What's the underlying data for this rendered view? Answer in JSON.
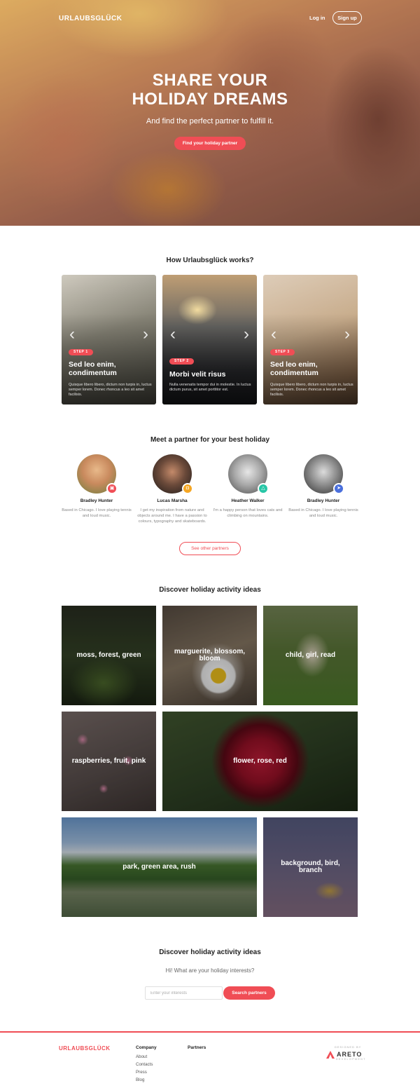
{
  "header": {
    "logo": "URLAUBSGLÜCK",
    "login_label": "Log in",
    "signup_label": "Sign up"
  },
  "hero": {
    "title_line1": "SHARE YOUR",
    "title_line2": "HOLIDAY DREAMS",
    "subtitle": "And find the perfect partner to fulfill it.",
    "cta_label": "Find your holiday partner"
  },
  "how_it_works": {
    "title": "How Urlaubsglück works?",
    "steps": [
      {
        "badge": "STEP 1",
        "title_line1": "Sed leo enim,",
        "title_line2": "condimentum",
        "text": "Quisque libero libero, dictum non turpis in, luctus semper lorem. Donec rhoncus a leo sit amet facilisis."
      },
      {
        "badge": "STEP 2",
        "title_line1": "Morbi velit risus",
        "title_line2": "",
        "text": "Nulla venenatis tempor dui in molestie. In luctus dictum purus, sit amet porttitor est."
      },
      {
        "badge": "STEP 3",
        "title_line1": "Sed leo enim,",
        "title_line2": "condimentum",
        "text": "Quisque libero libero, dictum non turpis in, luctus semper lorem. Donec rhoncus a leo sit amet facilisis."
      }
    ]
  },
  "partners": {
    "title": "Meet a partner for your best holiday",
    "items": [
      {
        "name": "Bradley Hunter",
        "desc": "Based in Chicago. I love playing tennis and loud music.",
        "badge_icon": "bag-icon",
        "badge_color": "#f04d55"
      },
      {
        "name": "Lucas Marsha",
        "desc": "I get my inspiration from nature and objects around me. I have a passion to colours, typography and skateboards.",
        "badge_icon": "lock-icon",
        "badge_color": "#f5a623"
      },
      {
        "name": "Heather Walker",
        "desc": "I'm a happy person that loves cats and climbing on mountains.",
        "badge_icon": "hanger-icon",
        "badge_color": "#26c6a6"
      },
      {
        "name": "Bradley Hunter",
        "desc": "Based in Chicago. I love playing tennis and loud music.",
        "badge_icon": "plane-icon",
        "badge_color": "#4a6fdc"
      }
    ],
    "see_more_label": "See other partners"
  },
  "activities": {
    "title": "Discover holiday activity ideas",
    "tiles": [
      {
        "label": "moss, forest, green"
      },
      {
        "label": "marguerite, blossom, bloom"
      },
      {
        "label": "child, girl, read"
      },
      {
        "label": "raspberries, fruit, pink"
      },
      {
        "label": "flower, rose, red"
      },
      {
        "label": "park, green area, rush"
      },
      {
        "label": "background, bird, branch"
      }
    ]
  },
  "search": {
    "title": "Discover holiday activity ideas",
    "subtitle": "Hi! What are your holiday interests?",
    "placeholder": "Enter your interests",
    "button_label": "Search partners"
  },
  "footer": {
    "logo": "URLAUBSGLÜCK",
    "company_title": "Company",
    "company_links": [
      "About",
      "Contacts",
      "Press",
      "Blog"
    ],
    "partners_title": "Partners",
    "designed_by": "DESIGNED BY",
    "designer_name": "ARETO",
    "designer_sub": "DEVELOPMENT"
  },
  "colors": {
    "accent": "#f04d55"
  }
}
